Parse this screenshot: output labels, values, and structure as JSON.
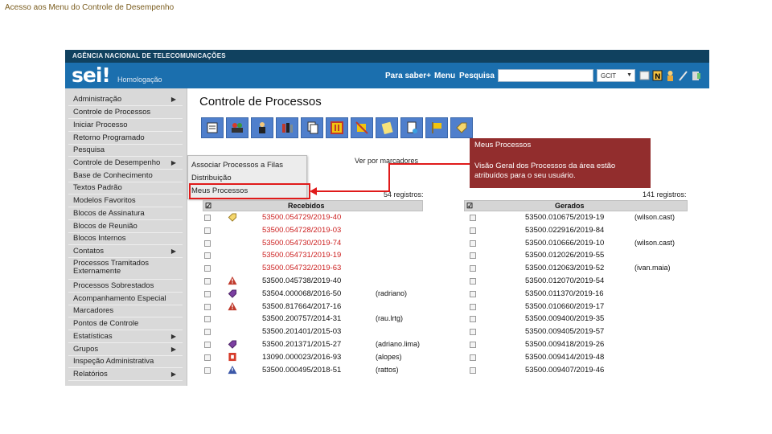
{
  "slide": {
    "caption": "Acesso aos Menu do Controle de Desempenho"
  },
  "topbar": {
    "agency": "AGÊNCIA NACIONAL DE TELECOMUNICAÇÕES"
  },
  "header": {
    "logo": "sei!",
    "environment": "Homologação",
    "nav": [
      "Para saber+",
      "Menu",
      "Pesquisa"
    ],
    "unit": "GCIT",
    "icons": [
      "notification-icon",
      "document-icon",
      "user-icon",
      "tools-icon",
      "exit-icon"
    ]
  },
  "sidebar": {
    "items": [
      {
        "label": "Administração",
        "submenu": true
      },
      {
        "label": "Controle de Processos",
        "submenu": false
      },
      {
        "label": "Iniciar Processo",
        "submenu": false
      },
      {
        "label": "Retorno Programado",
        "submenu": false
      },
      {
        "label": "Pesquisa",
        "submenu": false
      },
      {
        "label": "Controle de Desempenho",
        "submenu": true
      },
      {
        "label": "Base de Conhecimento",
        "submenu": false
      },
      {
        "label": "Textos Padrão",
        "submenu": false
      },
      {
        "label": "Modelos Favoritos",
        "submenu": false
      },
      {
        "label": "Blocos de Assinatura",
        "submenu": false
      },
      {
        "label": "Blocos de Reunião",
        "submenu": false
      },
      {
        "label": "Blocos Internos",
        "submenu": false
      },
      {
        "label": "Contatos",
        "submenu": true
      },
      {
        "label": "Processos Tramitados Externamente",
        "submenu": false
      },
      {
        "label": "Processos Sobrestados",
        "submenu": false
      },
      {
        "label": "Acompanhamento Especial",
        "submenu": false
      },
      {
        "label": "Marcadores",
        "submenu": false
      },
      {
        "label": "Pontos de Controle",
        "submenu": false
      },
      {
        "label": "Estatísticas",
        "submenu": true
      },
      {
        "label": "Grupos",
        "submenu": true
      },
      {
        "label": "Inspeção Administrativa",
        "submenu": false
      },
      {
        "label": "Relatórios",
        "submenu": true
      }
    ],
    "submenu_symbol": "▶"
  },
  "submenu": {
    "items": [
      "Associar Processos a Filas",
      "Distribuição",
      "Meus Processos"
    ]
  },
  "main": {
    "title": "Controle de Processos",
    "toolbar": [
      "sigilo-icon",
      "enviar-icon",
      "atribuir-icon",
      "incluir-bloco-icon",
      "sobrestar-icon",
      "concluir-icon",
      "anotacoes-icon",
      "documento-icon",
      "acompanhamento-icon",
      "marcador-icon"
    ],
    "filter_link": "Ver por marcadores",
    "received_count": "54 registros:",
    "generated_count": "141 registros:",
    "received_header": "Recebidos",
    "generated_header": "Gerados",
    "received": [
      {
        "num": "53500.054729/2019-40",
        "color": "red",
        "marker": "tag-yellow",
        "user": ""
      },
      {
        "num": "53500.054728/2019-03",
        "color": "red",
        "marker": "",
        "user": ""
      },
      {
        "num": "53500.054730/2019-74",
        "color": "red",
        "marker": "",
        "user": ""
      },
      {
        "num": "53500.054731/2019-19",
        "color": "red",
        "marker": "",
        "user": ""
      },
      {
        "num": "53500.054732/2019-63",
        "color": "red",
        "marker": "",
        "user": ""
      },
      {
        "num": "53500.045738/2019-40",
        "color": "black",
        "marker": "alert",
        "user": ""
      },
      {
        "num": "53504.000068/2016-50",
        "color": "black",
        "marker": "tag-purple",
        "user": "(radriano)"
      },
      {
        "num": "53500.817664/2017-16",
        "color": "black",
        "marker": "alert",
        "user": ""
      },
      {
        "num": "53500.200757/2014-31",
        "color": "black",
        "marker": "",
        "user": "(rau.lrtg)"
      },
      {
        "num": "53500.201401/2015-03",
        "color": "black",
        "marker": "",
        "user": ""
      },
      {
        "num": "53500.201371/2015-27",
        "color": "black",
        "marker": "tag-purple",
        "user": "(adriano.lima)"
      },
      {
        "num": "13090.000023/2016-93",
        "color": "black",
        "marker": "special",
        "user": "(alopes)"
      },
      {
        "num": "53500.000495/2018-51",
        "color": "black",
        "marker": "alert-blue",
        "user": "(rattos)"
      }
    ],
    "generated": [
      {
        "num": "53500.010675/2019-19",
        "user": "(wilson.cast)"
      },
      {
        "num": "53500.022916/2019-84",
        "user": ""
      },
      {
        "num": "53500.010666/2019-10",
        "user": "(wilson.cast)"
      },
      {
        "num": "53500.012026/2019-55",
        "user": ""
      },
      {
        "num": "53500.012063/2019-52",
        "user": "(ivan.maia)"
      },
      {
        "num": "53500.012070/2019-54",
        "user": ""
      },
      {
        "num": "53500.011370/2019-16",
        "user": ""
      },
      {
        "num": "53500.010660/2019-17",
        "user": ""
      },
      {
        "num": "53500.009400/2019-35",
        "user": ""
      },
      {
        "num": "53500.009405/2019-57",
        "user": ""
      },
      {
        "num": "53500.009418/2019-26",
        "user": ""
      },
      {
        "num": "53500.009414/2019-48",
        "user": ""
      },
      {
        "num": "53500.009407/2019-46",
        "user": ""
      }
    ]
  },
  "callout": {
    "title": "Meus Processos",
    "text": "Visão Geral dos Processos da área estão atribuídos para o seu usuário."
  },
  "colors": {
    "topbar": "#10415f",
    "header": "#1b6fae",
    "sidebar": "#d9d9d9",
    "callout": "#922d2d",
    "highlight": "#e01a1a",
    "process_red": "#cc1f1f"
  }
}
